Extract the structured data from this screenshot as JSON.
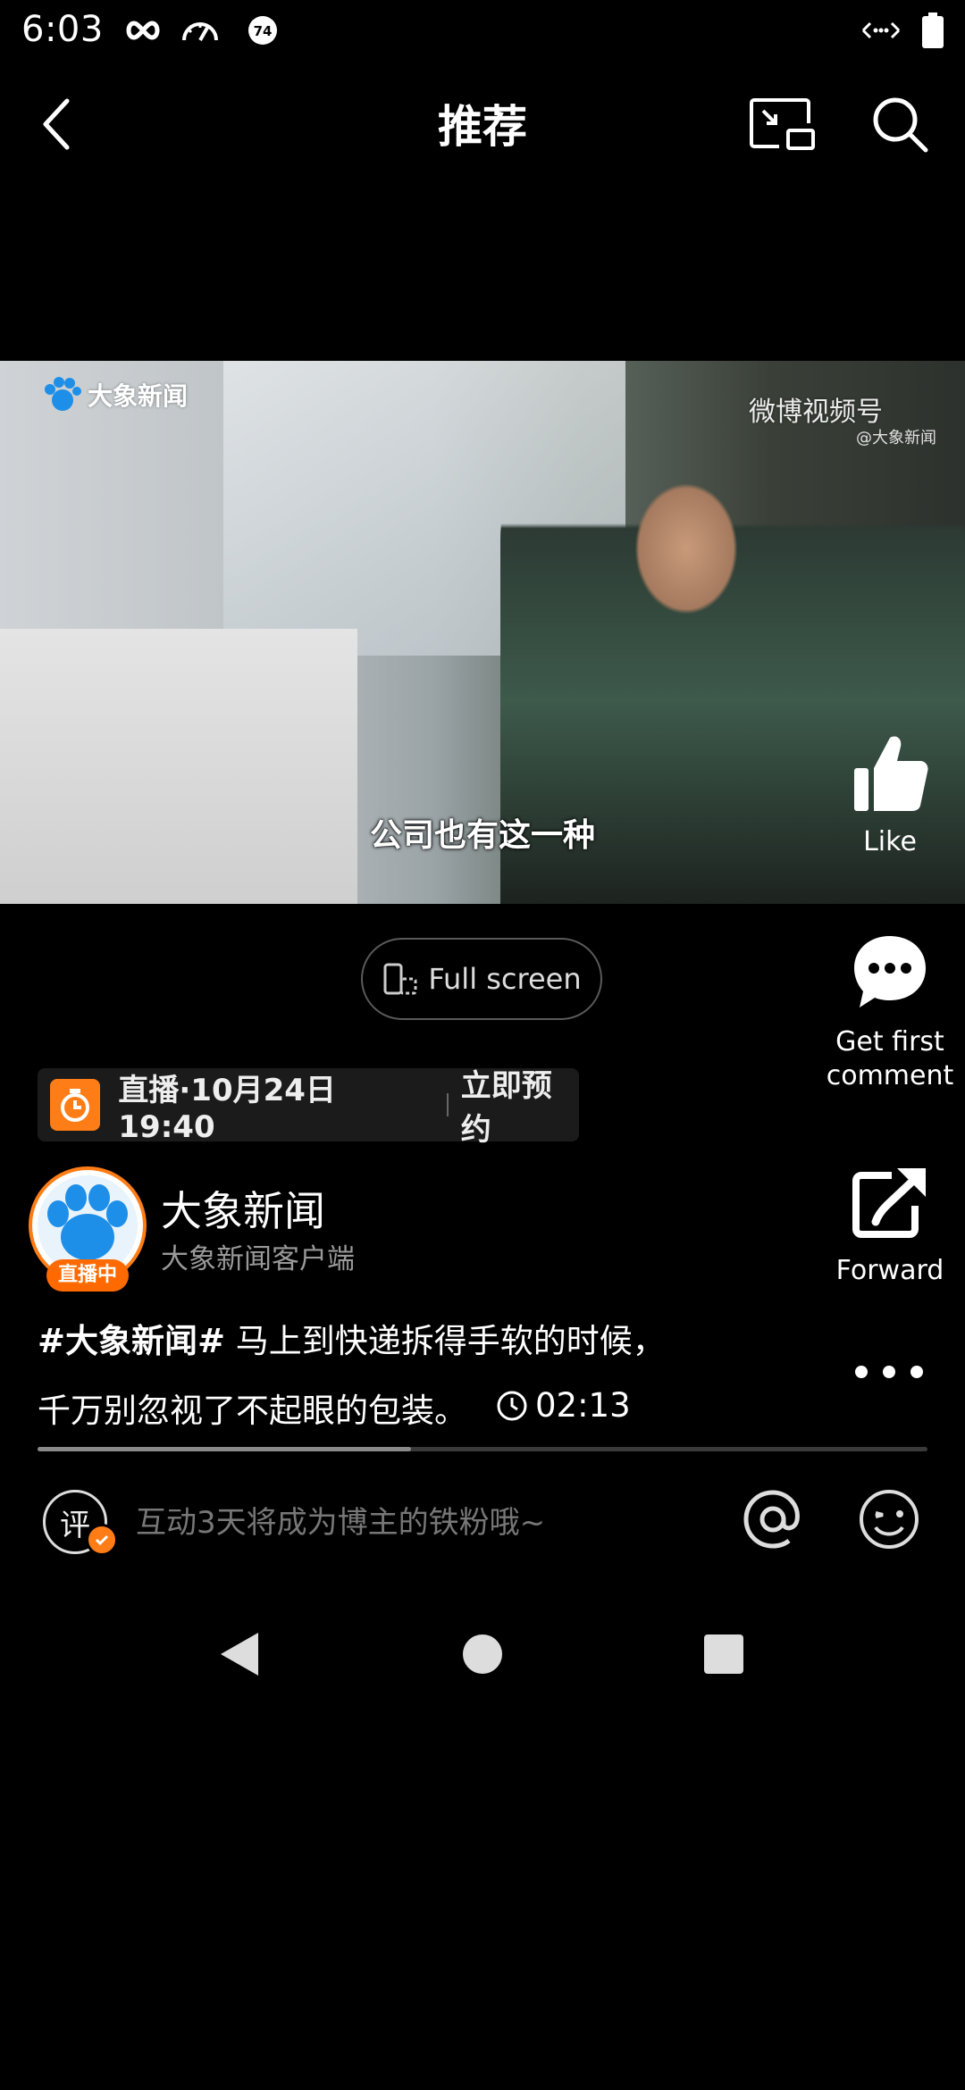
{
  "status_bar": {
    "time": "6:03",
    "badge_number": "74",
    "icons": [
      "infinity-icon",
      "speedometer-icon",
      "notification-badge-icon",
      "data-arrows-icon",
      "battery-icon"
    ]
  },
  "nav": {
    "title": "推荐",
    "icons": [
      "back-icon",
      "picture-in-picture-icon",
      "search-icon"
    ]
  },
  "video": {
    "logo_text": "大象新闻",
    "watermark": "微博视频号",
    "watermark_sub": "@大象新闻",
    "subtitle": "公司也有这一种"
  },
  "actions": {
    "like_label": "Like",
    "comment_label_line1": "Get first",
    "comment_label_line2": "comment",
    "forward_label": "Forward"
  },
  "fullscreen_label": "Full screen",
  "live": {
    "schedule": "直播·10月24日 19:40",
    "reserve": "立即预约"
  },
  "author": {
    "name": "大象新闻",
    "subtitle": "大象新闻客户端",
    "live_badge": "直播中"
  },
  "caption": {
    "hashtag": "#大象新闻#",
    "text_line1": " 马上到快递拆得手软的时候，",
    "text_line2": "千万别忽视了不起眼的包装。",
    "duration": "02:13"
  },
  "progress": {
    "fraction": 0.42
  },
  "comment_bar": {
    "icon_char": "评",
    "placeholder": "互动3天将成为博主的铁粉哦~"
  },
  "colors": {
    "background": "#000000",
    "accent_orange": "#ff7d16",
    "avatar_blue": "#1e8fe8"
  }
}
